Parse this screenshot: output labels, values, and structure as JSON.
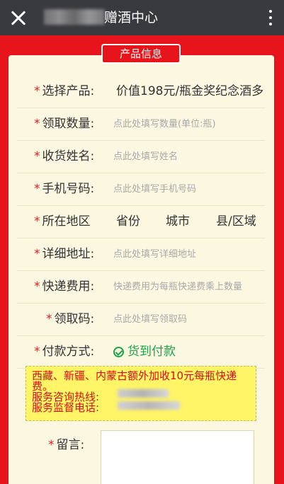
{
  "topbar": {
    "title": "赠酒中心"
  },
  "section_tab": "产品信息",
  "required_mark": "*",
  "form": {
    "product": {
      "label": "选择产品:",
      "value": "价值198元/瓶金奖纪念酒多"
    },
    "quantity": {
      "label": "领取数量:",
      "placeholder": "点此处填写数量(单位:瓶)"
    },
    "name": {
      "label": "收货姓名:",
      "placeholder": "点此处填写姓名"
    },
    "phone": {
      "label": "手机号码:",
      "placeholder": "点此处填写手机号码"
    },
    "region": {
      "label": "所在地区",
      "province": "省份",
      "city": "城市",
      "county": "县/区域"
    },
    "address": {
      "label": "详细地址:",
      "placeholder": "点此处填写详细地址"
    },
    "shipping": {
      "label": "快递费用:",
      "placeholder": "快递费用为每瓶快递费乘上数量"
    },
    "code": {
      "label": "领取码:",
      "placeholder": "点此处填写领取码"
    },
    "payment": {
      "label": "付款方式:",
      "value": "货到付款"
    }
  },
  "notice": {
    "line1": "西藏、新疆、内蒙古额外加收10元每瓶快递费。",
    "hotline_label": "服务咨询热线:",
    "supervision_label": "服务监督电话:"
  },
  "message": {
    "label": "留言:"
  }
}
